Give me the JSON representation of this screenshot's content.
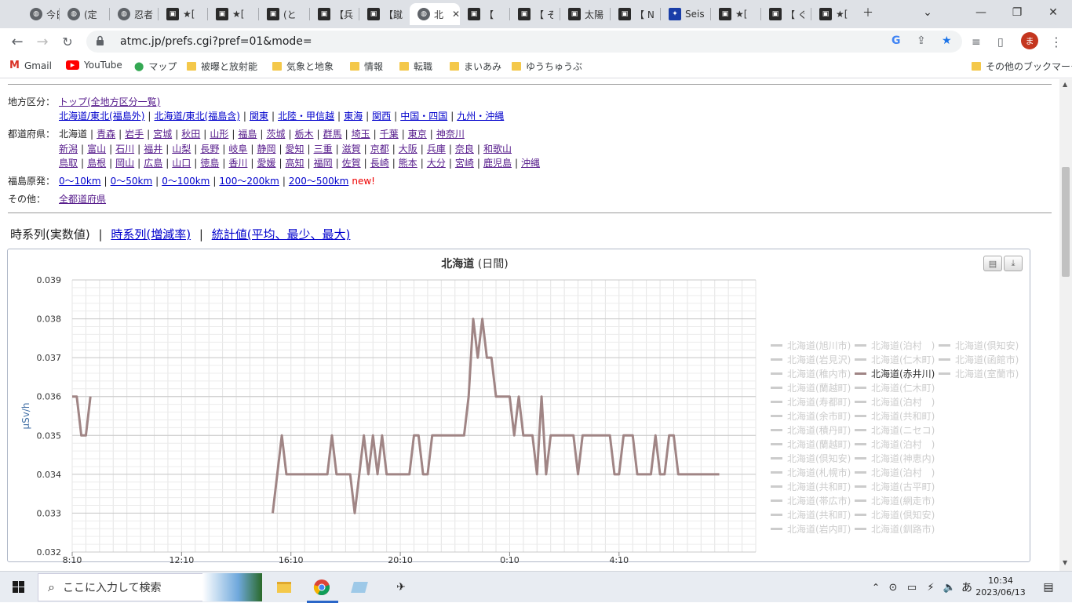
{
  "tabs": [
    {
      "title": "今日",
      "icon": "globe-icon"
    },
    {
      "title": "(定",
      "icon": "globe-icon"
    },
    {
      "title": "忍者",
      "icon": "globe-icon"
    },
    {
      "title": "★[",
      "icon": "site-icon"
    },
    {
      "title": "★[",
      "icon": "site-icon"
    },
    {
      "title": "(と",
      "icon": "site-icon"
    },
    {
      "title": "【兵",
      "icon": "site-icon"
    },
    {
      "title": "【蹴",
      "icon": "site-icon"
    },
    {
      "title": "北",
      "icon": "globe-icon",
      "active": true
    },
    {
      "title": "【 ",
      "icon": "site-icon"
    },
    {
      "title": "【 そ",
      "icon": "site-icon"
    },
    {
      "title": "太陽",
      "icon": "site-icon"
    },
    {
      "title": "【 N",
      "icon": "site-icon"
    },
    {
      "title": "Seis",
      "icon": "seis-icon"
    },
    {
      "title": "★[",
      "icon": "site-icon"
    },
    {
      "title": "【 ぐ",
      "icon": "site-icon"
    },
    {
      "title": "★[",
      "icon": "site-icon"
    }
  ],
  "address": {
    "url": "atmc.jp/prefs.cgi?pref=01&mode="
  },
  "avatar_letter": "ま",
  "bookmarks": [
    {
      "label": "Gmail",
      "icon": "gmail-icon"
    },
    {
      "label": "YouTube",
      "icon": "youtube-icon"
    },
    {
      "label": "マップ",
      "icon": "maps-icon"
    },
    {
      "label": "被曝と放射能",
      "icon": "folder-icon"
    },
    {
      "label": "気象と地象",
      "icon": "folder-icon"
    },
    {
      "label": "情報",
      "icon": "folder-icon"
    },
    {
      "label": "転職",
      "icon": "folder-icon"
    },
    {
      "label": "まいあみ",
      "icon": "folder-icon"
    },
    {
      "label": "ゆうちゅうぶ",
      "icon": "folder-icon"
    }
  ],
  "other_bookmarks": "その他のブックマーク",
  "nav": {
    "region_label": "地方区分：",
    "region_top": "トップ(全地方区分一覧)",
    "regions": [
      "北海道/東北(福島外)",
      "北海道/東北(福島含)",
      "関東",
      "北陸・甲信越",
      "東海",
      "関西",
      "中国・四国",
      "九州・沖縄"
    ],
    "pref_label": "都道府県：",
    "pref_current": "北海道",
    "prefs_row1": [
      "青森",
      "岩手",
      "宮城",
      "秋田",
      "山形",
      "福島",
      "茨城",
      "栃木",
      "群馬",
      "埼玉",
      "千葉",
      "東京",
      "神奈川"
    ],
    "prefs_row2": [
      "新潟",
      "富山",
      "石川",
      "福井",
      "山梨",
      "長野",
      "岐阜",
      "静岡",
      "愛知",
      "三重",
      "滋賀",
      "京都",
      "大阪",
      "兵庫",
      "奈良",
      "和歌山"
    ],
    "prefs_row3": [
      "鳥取",
      "島根",
      "岡山",
      "広島",
      "山口",
      "徳島",
      "香川",
      "愛媛",
      "高知",
      "福岡",
      "佐賀",
      "長崎",
      "熊本",
      "大分",
      "宮崎",
      "鹿児島",
      "沖縄"
    ],
    "fukushima_label": "福島原発：",
    "fukushima": [
      "0〜10km",
      "0〜50km",
      "0〜100km",
      "100〜200km",
      "200〜500km"
    ],
    "new_tag": "new!",
    "other_label": "その他：",
    "other_link": "全都道府県"
  },
  "modes": {
    "current": "時系列(実数値)",
    "links": [
      "時系列(増減率)",
      "統計値(平均、最少、最大)"
    ],
    "sep": "|"
  },
  "chart_data": {
    "type": "line",
    "title": "北海道",
    "subtitle": "(日間)",
    "ylabel": "μSv/h",
    "ylim": [
      0.032,
      0.039
    ],
    "yticks": [
      "0.039",
      "0.038",
      "0.037",
      "0.036",
      "0.035",
      "0.034",
      "0.033",
      "0.032"
    ],
    "xticks": [
      "8:10",
      "12:10",
      "16:10",
      "20:10",
      "0:10",
      "4:10"
    ],
    "x_minutes_from_first_tick": [
      0,
      240,
      480,
      720,
      960,
      1200
    ],
    "highlighted_series": "北海道(赤井川)",
    "series": [
      {
        "name": "北海道(赤井川)",
        "color": "#a08585",
        "segments": [
          [
            [
              0,
              0.036
            ],
            [
              10,
              0.036
            ],
            [
              20,
              0.035
            ],
            [
              30,
              0.035
            ],
            [
              40,
              0.036
            ]
          ],
          [
            [
              440,
              0.033
            ],
            [
              460,
              0.035
            ],
            [
              470,
              0.034
            ],
            [
              560,
              0.034
            ],
            [
              570,
              0.035
            ],
            [
              580,
              0.034
            ],
            [
              610,
              0.034
            ],
            [
              620,
              0.033
            ],
            [
              640,
              0.035
            ],
            [
              650,
              0.034
            ],
            [
              660,
              0.035
            ],
            [
              670,
              0.034
            ],
            [
              680,
              0.035
            ],
            [
              690,
              0.034
            ],
            [
              740,
              0.034
            ],
            [
              750,
              0.035
            ],
            [
              760,
              0.035
            ],
            [
              770,
              0.034
            ],
            [
              780,
              0.034
            ],
            [
              790,
              0.035
            ],
            [
              860,
              0.035
            ],
            [
              870,
              0.036
            ],
            [
              880,
              0.038
            ],
            [
              890,
              0.037
            ],
            [
              900,
              0.038
            ],
            [
              910,
              0.037
            ],
            [
              920,
              0.037
            ],
            [
              930,
              0.036
            ],
            [
              960,
              0.036
            ],
            [
              970,
              0.035
            ],
            [
              980,
              0.036
            ],
            [
              990,
              0.035
            ],
            [
              1010,
              0.035
            ],
            [
              1020,
              0.034
            ],
            [
              1030,
              0.036
            ],
            [
              1040,
              0.034
            ],
            [
              1050,
              0.035
            ],
            [
              1100,
              0.035
            ],
            [
              1110,
              0.034
            ],
            [
              1120,
              0.035
            ],
            [
              1180,
              0.035
            ],
            [
              1190,
              0.034
            ],
            [
              1200,
              0.034
            ],
            [
              1210,
              0.035
            ],
            [
              1230,
              0.035
            ],
            [
              1240,
              0.034
            ],
            [
              1270,
              0.034
            ],
            [
              1280,
              0.035
            ],
            [
              1290,
              0.034
            ],
            [
              1300,
              0.034
            ],
            [
              1310,
              0.035
            ],
            [
              1320,
              0.035
            ],
            [
              1330,
              0.034
            ],
            [
              1420,
              0.034
            ]
          ]
        ]
      }
    ],
    "legend": {
      "placement": "right",
      "columns": [
        [
          "北海道(旭川市)",
          "北海道(岩見沢)",
          "北海道(稚内市)",
          "北海道(蘭越町)",
          "北海道(寿都町)",
          "北海道(余市町)",
          "北海道(積丹町)",
          "北海道(蘭越町)",
          "北海道(倶知安)",
          "北海道(札幌市)",
          "北海道(共和町)",
          "北海道(帯広市)",
          "北海道(共和町)",
          "北海道(岩内町)"
        ],
        [
          "北海道(泊村　)",
          "北海道(仁木町)",
          "北海道(赤井川)",
          "北海道(仁木町)",
          "北海道(泊村　)",
          "北海道(共和町)",
          "北海道(ニセコ)",
          "北海道(泊村　)",
          "北海道(神恵内)",
          "北海道(泊村　)",
          "北海道(古平町)",
          "北海道(網走市)",
          "北海道(倶知安)",
          "北海道(釧路市)"
        ],
        [
          "北海道(倶知安)",
          "北海道(函館市)",
          "北海道(室蘭市)"
        ]
      ]
    }
  },
  "taskbar": {
    "search_placeholder": "ここに入力して検索",
    "time": "10:34",
    "date": "2023/06/13",
    "ime": "あ"
  }
}
